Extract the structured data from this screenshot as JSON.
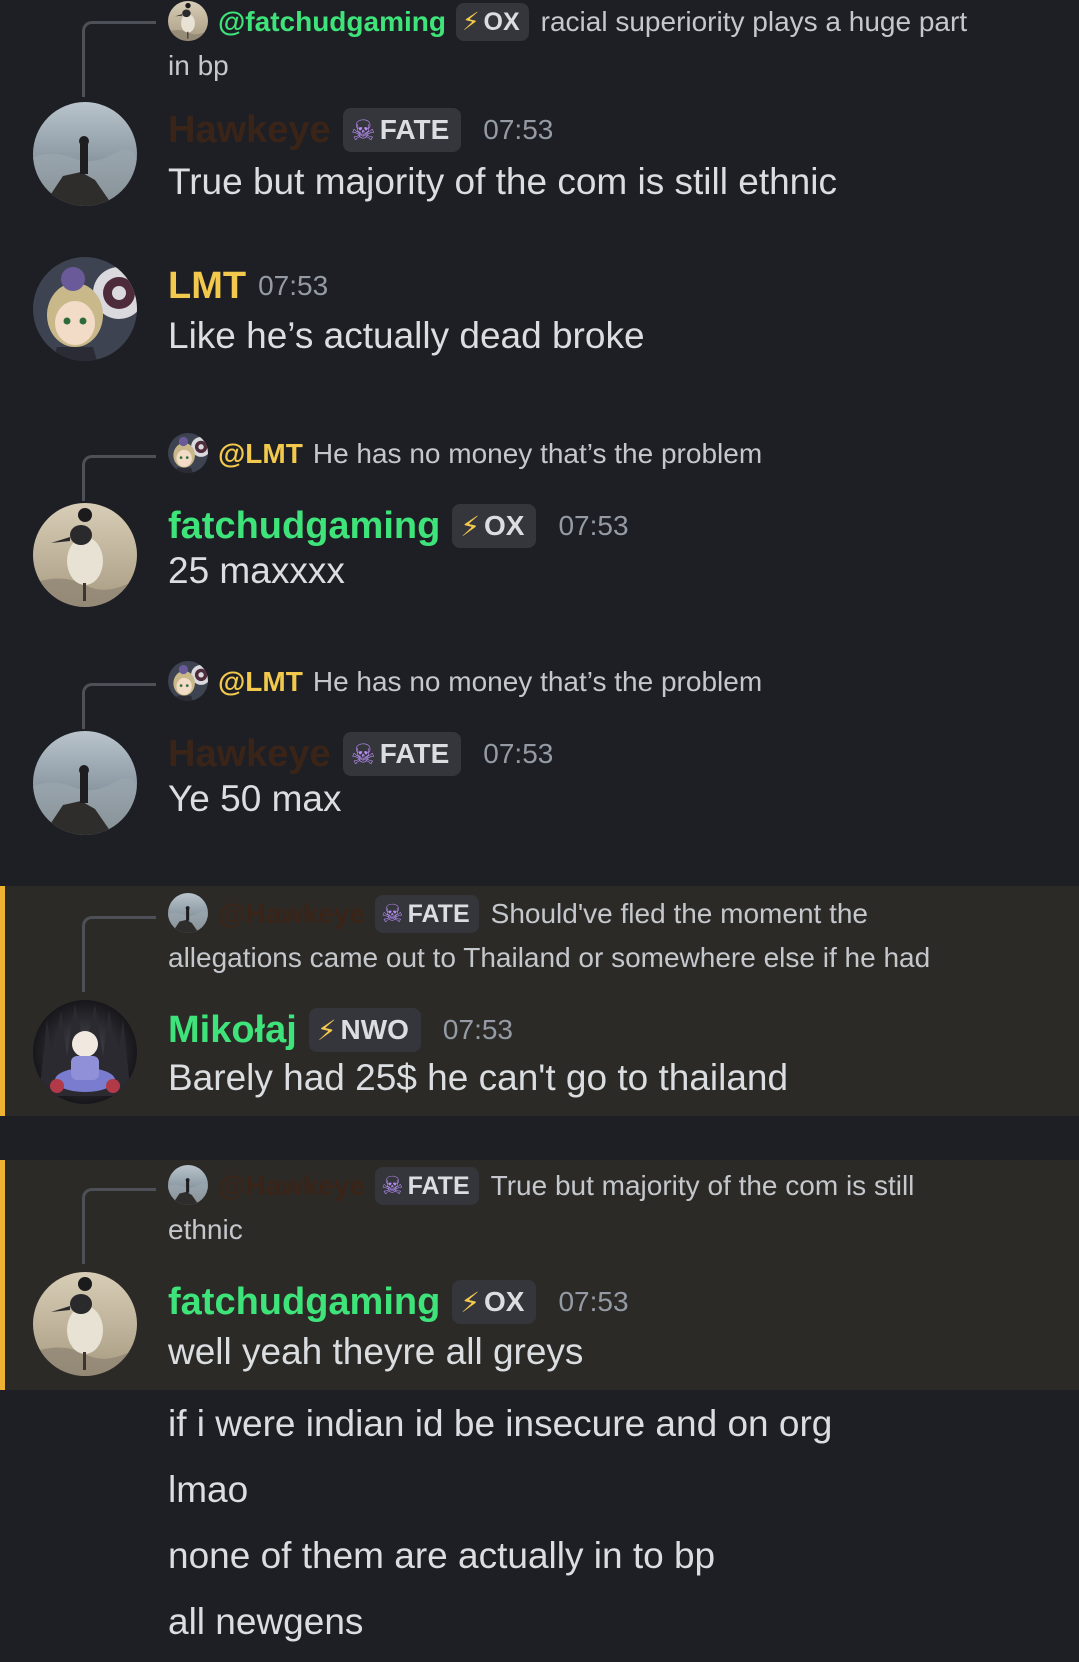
{
  "colors": {
    "background": "#1e1f24",
    "mention_highlight": "#2c2a27",
    "mention_bar": "#f0b232",
    "green_name": "#3ee37a",
    "yellow_name": "#f2c94c",
    "dark_name": "#3a2418",
    "timestamp": "#949ba4"
  },
  "messages": [
    {
      "reply": {
        "mention": "@fatchudgaming",
        "badge": {
          "icon": "lightning-icon",
          "text": "OX"
        },
        "text_line1": "racial superiority plays a huge part",
        "text_line2": "in bp"
      },
      "author": "Hawkeye",
      "badge": {
        "icon": "skull-icon",
        "text": "FATE"
      },
      "time": "07:53",
      "content": "True but majority of the com is still ethnic"
    },
    {
      "author": "LMT",
      "time": "07:53",
      "content": "Like he’s actually dead broke"
    },
    {
      "reply": {
        "mention": "@LMT",
        "text_line1": "He has no money that’s the problem"
      },
      "author": "fatchudgaming",
      "badge": {
        "icon": "lightning-icon",
        "text": "OX"
      },
      "time": "07:53",
      "content": "25 maxxxx"
    },
    {
      "reply": {
        "mention": "@LMT",
        "text_line1": "He has no money that’s the problem"
      },
      "author": "Hawkeye",
      "badge": {
        "icon": "skull-icon",
        "text": "FATE"
      },
      "time": "07:53",
      "content": "Ye 50 max"
    },
    {
      "reply": {
        "mention": "@Hawkeye",
        "badge": {
          "icon": "skull-icon",
          "text": "FATE"
        },
        "text_line1": "Should've fled the moment the",
        "text_line2": "allegations came out to Thailand or somewhere else if he had"
      },
      "author": "Mikołaj",
      "badge": {
        "icon": "lightning-icon",
        "text": "NWO"
      },
      "time": "07:53",
      "content": "Barely had 25$ he can't go to thailand"
    },
    {
      "reply": {
        "mention": "@Hawkeye",
        "badge": {
          "icon": "skull-icon",
          "text": "FATE"
        },
        "text_line1": "True but majority of the com is still",
        "text_line2": "ethnic"
      },
      "author": "fatchudgaming",
      "badge": {
        "icon": "lightning-icon",
        "text": "OX"
      },
      "time": "07:53",
      "content": "well yeah theyre all greys"
    }
  ],
  "followups": [
    "if i were indian id be insecure and on org",
    "lmao",
    "none of them are actually in to bp",
    "all newgens"
  ]
}
